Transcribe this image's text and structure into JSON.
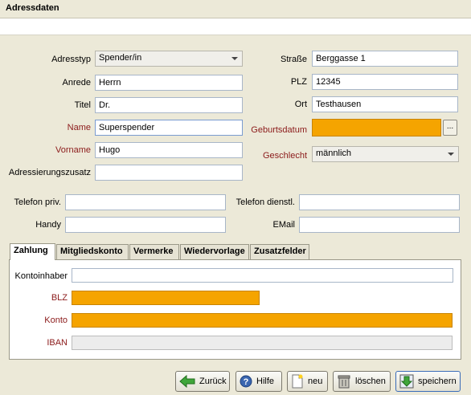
{
  "window": {
    "title": "Adressdaten"
  },
  "left": {
    "adresstyp": {
      "label": "Adresstyp",
      "value": "Spender/in"
    },
    "anrede": {
      "label": "Anrede",
      "value": "Herrn"
    },
    "titel": {
      "label": "Titel",
      "value": "Dr."
    },
    "name": {
      "label": "Name",
      "value": "Superspender"
    },
    "vorname": {
      "label": "Vorname",
      "value": "Hugo"
    },
    "zusatz": {
      "label": "Adressierungszusatz",
      "value": ""
    }
  },
  "right": {
    "strasse": {
      "label": "Straße",
      "value": "Berggasse 1"
    },
    "plz": {
      "label": "PLZ",
      "value": "12345"
    },
    "ort": {
      "label": "Ort",
      "value": "Testhausen"
    },
    "geburtsdatum": {
      "label": "Geburtsdatum",
      "value": "",
      "button": "..."
    },
    "geschlecht": {
      "label": "Geschlecht",
      "value": "männlich"
    }
  },
  "contact": {
    "telefon_priv": {
      "label": "Telefon priv.",
      "value": ""
    },
    "telefon_dienst": {
      "label": "Telefon dienstl.",
      "value": ""
    },
    "handy": {
      "label": "Handy",
      "value": ""
    },
    "email": {
      "label": "EMail",
      "value": ""
    }
  },
  "tabs": [
    "Zahlung",
    "Mitgliedskonto",
    "Vermerke",
    "Wiedervorlage",
    "Zusatzfelder"
  ],
  "zahlung": {
    "kontoinhaber": {
      "label": "Kontoinhaber",
      "value": ""
    },
    "blz": {
      "label": "BLZ",
      "value": ""
    },
    "konto": {
      "label": "Konto",
      "value": ""
    },
    "iban": {
      "label": "IBAN",
      "value": ""
    }
  },
  "buttons": {
    "zurueck": "Zurück",
    "hilfe": "Hilfe",
    "neu": "neu",
    "loeschen": "löschen",
    "speichern": "speichern"
  },
  "colors": {
    "required_field": "#f5a400",
    "required_label": "#8b1a1a"
  }
}
